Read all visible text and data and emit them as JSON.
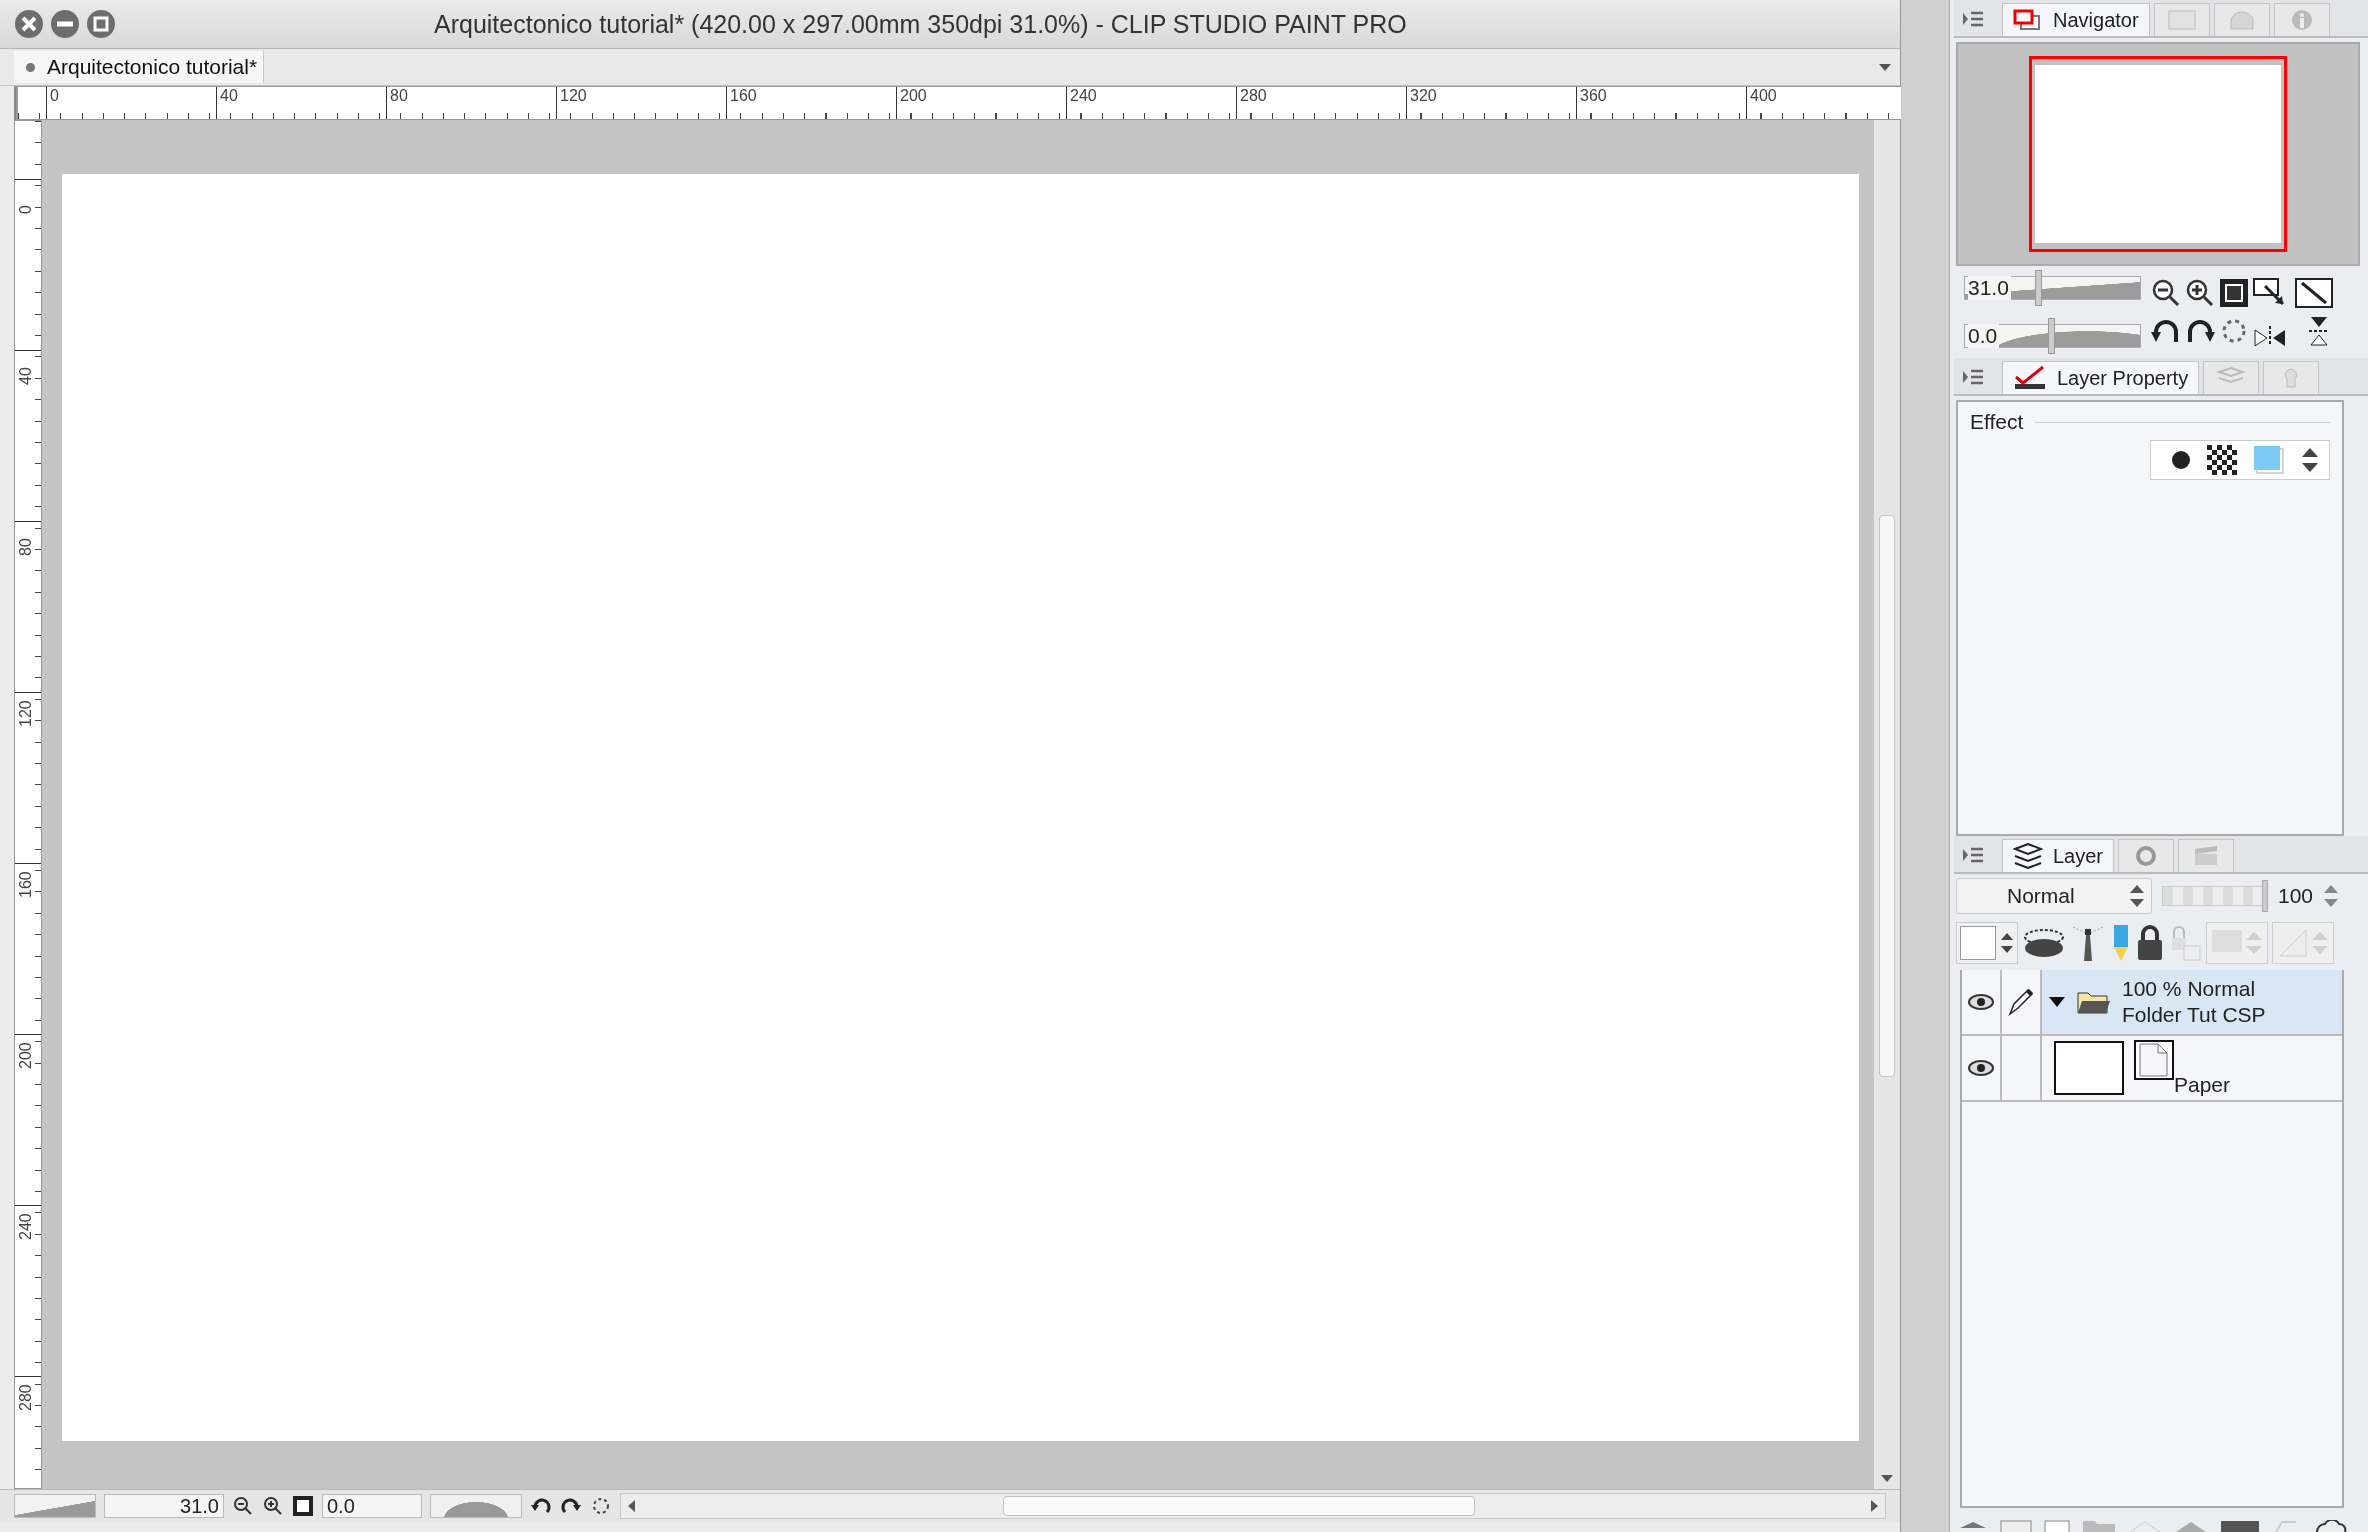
{
  "window": {
    "title": "Arquitectonico tutorial* (420.00 x 297.00mm 350dpi 31.0%)  - CLIP STUDIO PAINT PRO"
  },
  "document_tabs": [
    {
      "label": "Arquitectonico tutorial*",
      "selected": true
    }
  ],
  "ruler": {
    "top_ticks": [
      "0",
      "40",
      "80",
      "120",
      "160",
      "200",
      "240",
      "280",
      "320",
      "360",
      "400"
    ],
    "left_ticks": [
      "0",
      "40",
      "80",
      "120",
      "160",
      "200",
      "240",
      "280"
    ]
  },
  "bottom_bar": {
    "zoom": "31.0",
    "rotation": "0.0"
  },
  "navigator": {
    "tab": "Navigator",
    "zoom": {
      "value": "31.0",
      "level": 0.42
    },
    "rotation": {
      "value": "0.0",
      "level": 0.5
    }
  },
  "layer_property": {
    "tab": "Layer Property",
    "section": "Effect"
  },
  "layer_panel": {
    "tab": "Layer",
    "blend_mode": "Normal",
    "opacity": {
      "value": "100",
      "level": 1
    },
    "layers": [
      {
        "kind": "folder",
        "info": "100 % Normal",
        "name": "Folder Tut CSP",
        "selected": true,
        "visible": true,
        "expanded": true
      },
      {
        "kind": "paper",
        "name": "Paper",
        "selected": false,
        "visible": true
      }
    ]
  }
}
